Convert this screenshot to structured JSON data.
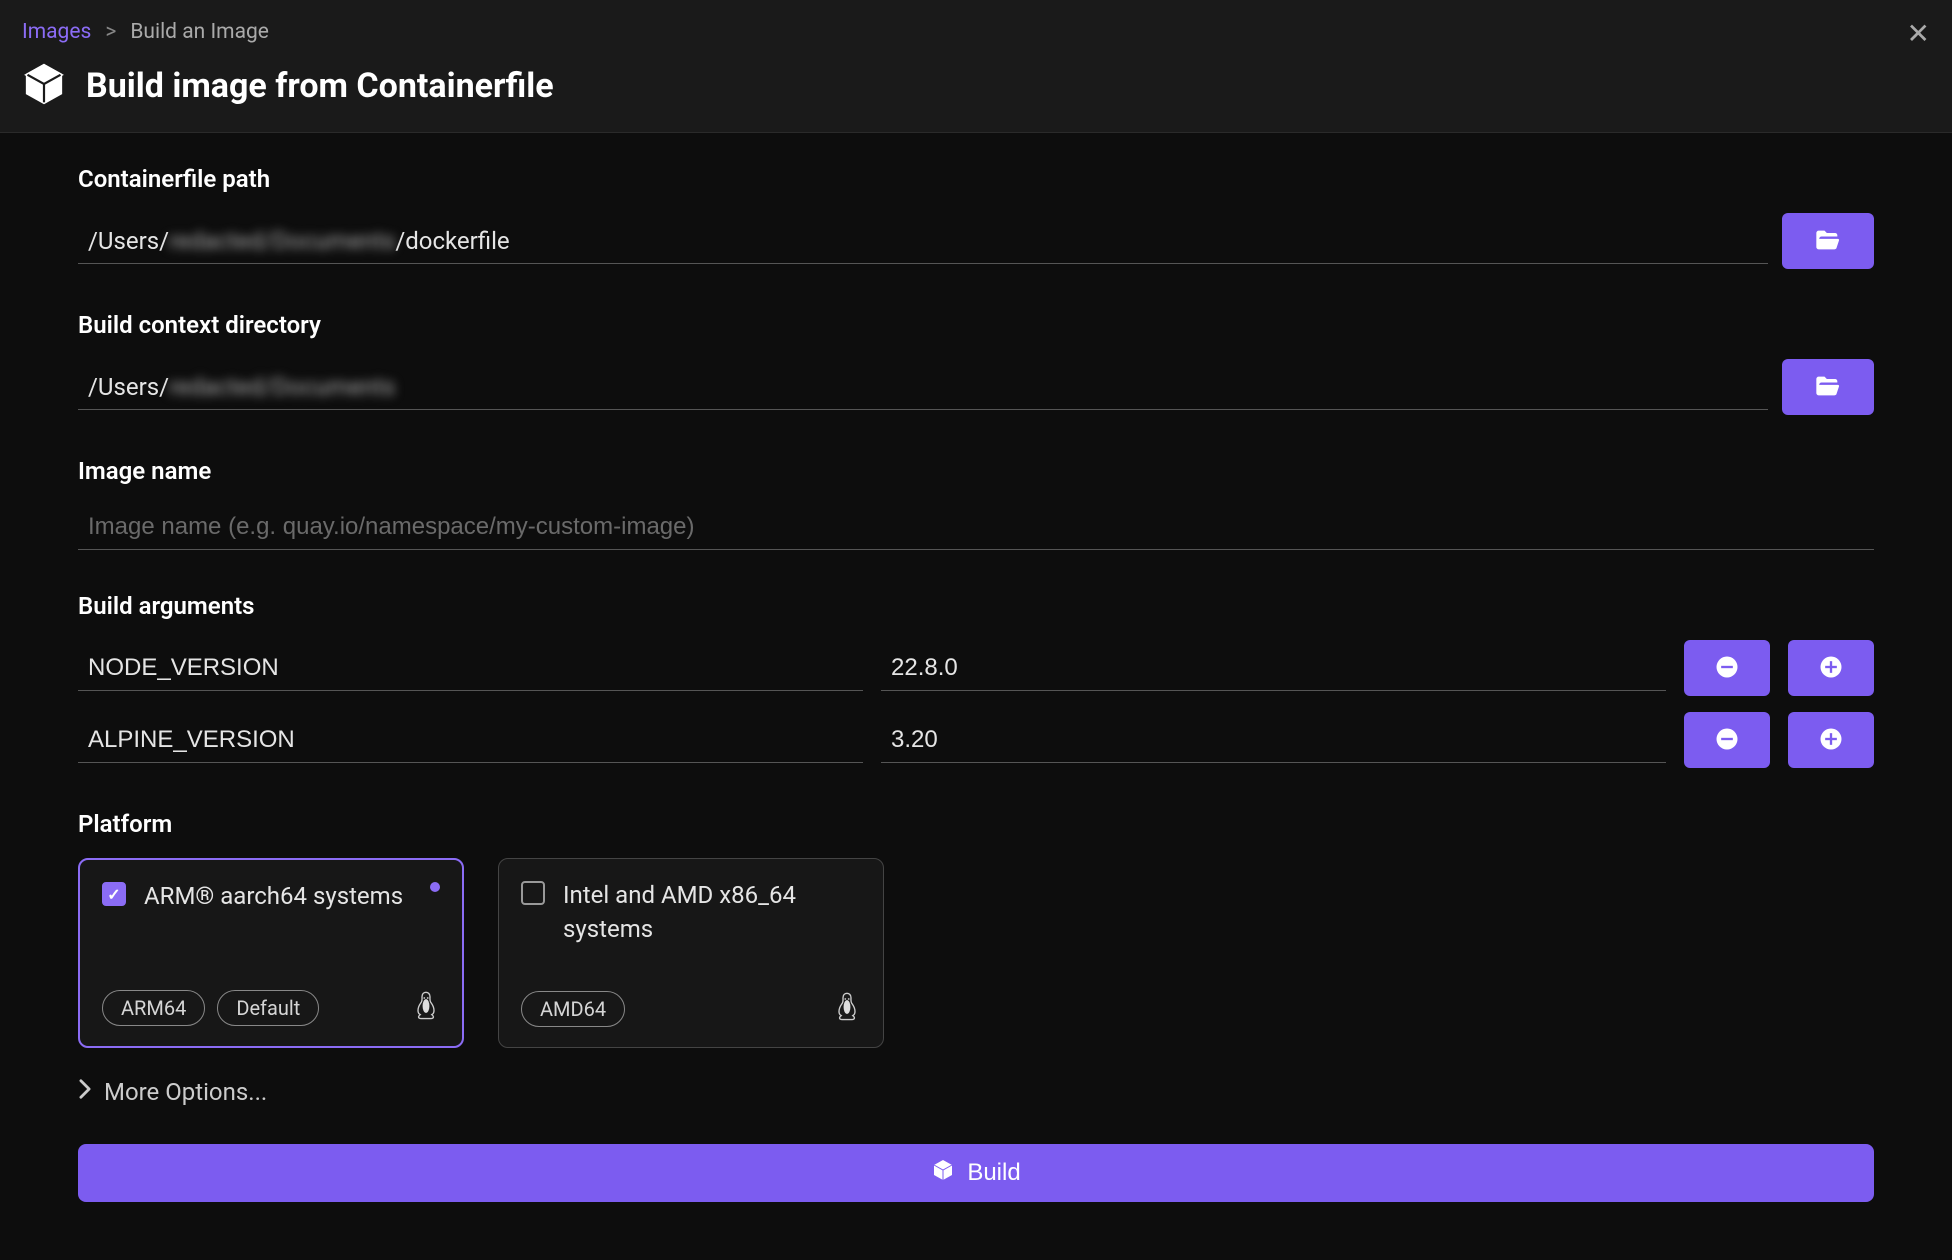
{
  "breadcrumb": {
    "root": "Images",
    "current": "Build an Image"
  },
  "title": "Build image from Containerfile",
  "fields": {
    "containerfile_path": {
      "label": "Containerfile path",
      "value_prefix": "/Users/",
      "value_blurred": "redacted/Documents",
      "value_suffix": "/dockerfile"
    },
    "build_context": {
      "label": "Build context directory",
      "value_prefix": "/Users/",
      "value_blurred": "redacted/Documents",
      "value_suffix": ""
    },
    "image_name": {
      "label": "Image name",
      "placeholder": "Image name (e.g. quay.io/namespace/my-custom-image)"
    },
    "build_args": {
      "label": "Build arguments",
      "rows": [
        {
          "key": "NODE_VERSION",
          "value": "22.8.0"
        },
        {
          "key": "ALPINE_VERSION",
          "value": "3.20"
        }
      ]
    },
    "platform": {
      "label": "Platform",
      "options": [
        {
          "label": "ARM® aarch64 systems",
          "tags": [
            "ARM64",
            "Default"
          ],
          "checked": true
        },
        {
          "label": "Intel and AMD x86_64 systems",
          "tags": [
            "AMD64"
          ],
          "checked": false
        }
      ]
    }
  },
  "more_options_label": "More Options...",
  "build_button_label": "Build"
}
